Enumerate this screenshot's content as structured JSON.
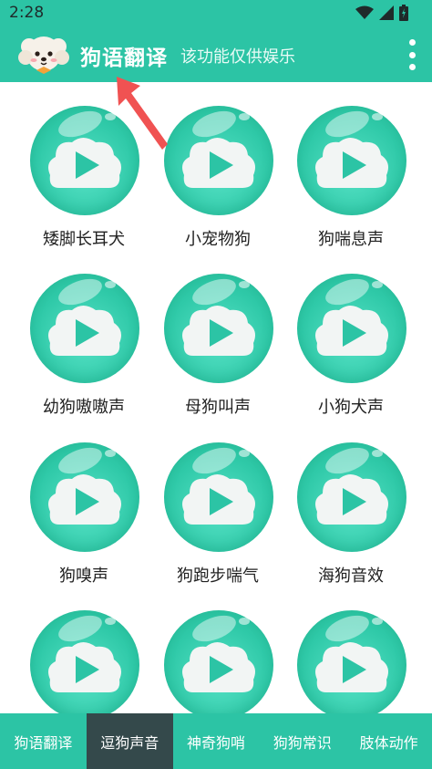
{
  "status": {
    "time": "2:28"
  },
  "header": {
    "title": "狗语翻译",
    "subtitle": "该功能仅供娱乐",
    "logo_icon": "dog-avatar-icon",
    "menu_icon": "more-vert-icon"
  },
  "colors": {
    "accent": "#2cc4a5",
    "nav_active": "#34494b",
    "arrow": "#f05252"
  },
  "sounds": [
    {
      "label": "矮脚长耳犬"
    },
    {
      "label": "小宠物狗"
    },
    {
      "label": "狗喘息声"
    },
    {
      "label": "幼狗嗷嗷声"
    },
    {
      "label": "母狗叫声"
    },
    {
      "label": "小狗犬声"
    },
    {
      "label": "狗嗅声"
    },
    {
      "label": "狗跑步喘气"
    },
    {
      "label": "海狗音效"
    },
    {
      "label": ""
    },
    {
      "label": ""
    },
    {
      "label": ""
    }
  ],
  "bottom_nav": {
    "items": [
      {
        "label": "狗语翻译",
        "active": false
      },
      {
        "label": "逗狗声音",
        "active": true
      },
      {
        "label": "神奇狗哨",
        "active": false
      },
      {
        "label": "狗狗常识",
        "active": false
      },
      {
        "label": "肢体动作",
        "active": false
      }
    ]
  }
}
